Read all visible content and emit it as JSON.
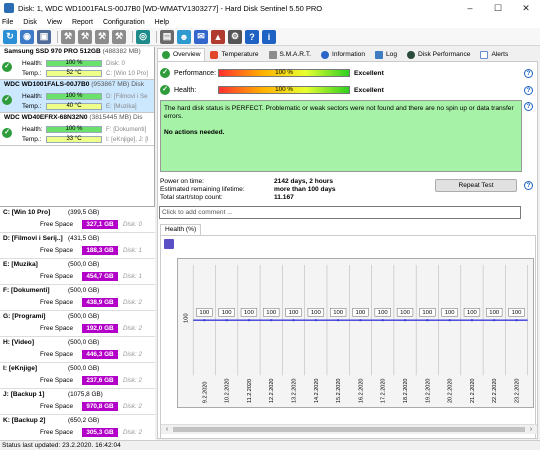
{
  "window": {
    "title": "Disk: 1, WDC WD1001FALS-00J7B0 [WD-WMATV1303277]  -  Hard Disk Sentinel 5.50 PRO"
  },
  "menu": [
    "File",
    "Disk",
    "View",
    "Report",
    "Configuration",
    "Help"
  ],
  "disks": [
    {
      "name": "Samsung SSD 970 PRO 512GB",
      "size": "(488382 MB)",
      "health_label": "Health:",
      "health": "100 %",
      "health_info": "Disk: 0",
      "temp_label": "Temp.:",
      "temp": "52 °C",
      "temp_info": "C: [Win 10 Pro]"
    },
    {
      "name": "WDC WD1001FALS-00J7B0",
      "size": "(953867 MB)",
      "extra": "Disk",
      "health_label": "Health:",
      "health": "100 %",
      "health_info": "D: [Filmovi i Se",
      "temp_label": "Temp.:",
      "temp": "40 °C",
      "temp_info": "E: [Muzika]"
    },
    {
      "name": "WDC WD40EFRX-68N32N0",
      "size": "(3815445 MB)",
      "extra": "Dis",
      "health_label": "Health:",
      "health": "100 %",
      "health_info": "F: [Dokumenti]",
      "temp_label": "Temp.:",
      "temp": "33 °C",
      "temp_info": "I: [eKnjige], J: [I"
    }
  ],
  "volumes": [
    {
      "name": "C: [Win 10 Pro]",
      "size": "(399,5 GB)",
      "free_label": "Free Space",
      "free": "327,1 GB",
      "disk": "Disk: 0"
    },
    {
      "name": "D: [Filmovi i Serij..]",
      "size": "(431,5 GB)",
      "free_label": "Free Space",
      "free": "188,3 GB",
      "disk": "Disk: 1"
    },
    {
      "name": "E: [Muzika]",
      "size": "(500,0 GB)",
      "free_label": "Free Space",
      "free": "454,7 GB",
      "disk": "Disk: 1"
    },
    {
      "name": "F: [Dokumenti]",
      "size": "(500,0 GB)",
      "free_label": "Free Space",
      "free": "438,9 GB",
      "disk": "Disk: 2"
    },
    {
      "name": "G: [Programi]",
      "size": "(500,0 GB)",
      "free_label": "Free Space",
      "free": "192,0 GB",
      "disk": "Disk: 2"
    },
    {
      "name": "H: [Video]",
      "size": "(500,0 GB)",
      "free_label": "Free Space",
      "free": "446,3 GB",
      "disk": "Disk: 2"
    },
    {
      "name": "I: [eKnjige]",
      "size": "(500,0 GB)",
      "free_label": "Free Space",
      "free": "237,6 GB",
      "disk": "Disk: 2"
    },
    {
      "name": "J: [Backup 1]",
      "size": "(1075,8 GB)",
      "free_label": "Free Space",
      "free": "970,8 GB",
      "disk": "Disk: 2"
    },
    {
      "name": "K: [Backup 2]",
      "size": "(650,2 GB)",
      "free_label": "Free Space",
      "free": "305,3 GB",
      "disk": "Disk: 2"
    }
  ],
  "tabs": [
    "Overview",
    "Temperature",
    "S.M.A.R.T.",
    "Information",
    "Log",
    "Disk Performance",
    "Alerts"
  ],
  "overview": {
    "performance_label": "Performance:",
    "performance_value": "100 %",
    "performance_rating": "Excellent",
    "health_label": "Health:",
    "health_value": "100 %",
    "health_rating": "Excellent",
    "status_text": "The hard disk status is PERFECT. Problematic or weak sectors were not found and there are no spin up or data transfer errors.",
    "status_action": "No actions needed.",
    "power_on_label": "Power on time:",
    "power_on_value": "2142 days, 2 hours",
    "remaining_label": "Estimated remaining lifetime:",
    "remaining_value": "more than 100 days",
    "startstop_label": "Total start/stop count:",
    "startstop_value": "11.167",
    "repeat_button": "Repeat Test",
    "comment_placeholder": "Click to add comment ...",
    "health_tab": "Health (%)"
  },
  "chart_data": {
    "type": "line",
    "x": [
      "9.2.2020",
      "10.2.2020",
      "11.2.2020",
      "12.2.2020",
      "13.2.2020",
      "14.2.2020",
      "15.2.2020",
      "16.2.2020",
      "17.2.2020",
      "18.2.2020",
      "19.2.2020",
      "20.2.2020",
      "21.2.2020",
      "22.2.2020",
      "23.2.2020"
    ],
    "series": [
      {
        "values": [
          100,
          100,
          100,
          100,
          100,
          100,
          100,
          100,
          100,
          100,
          100,
          100,
          100,
          100,
          100
        ]
      }
    ],
    "ytick": "100",
    "grid": true,
    "colors": {
      "line": "#3a3adb",
      "grid": "#bbbbbb",
      "background": "#f4f4f4"
    }
  },
  "statusbar": {
    "text": "Status last updated: 23.2.2020. 16:42:04"
  }
}
